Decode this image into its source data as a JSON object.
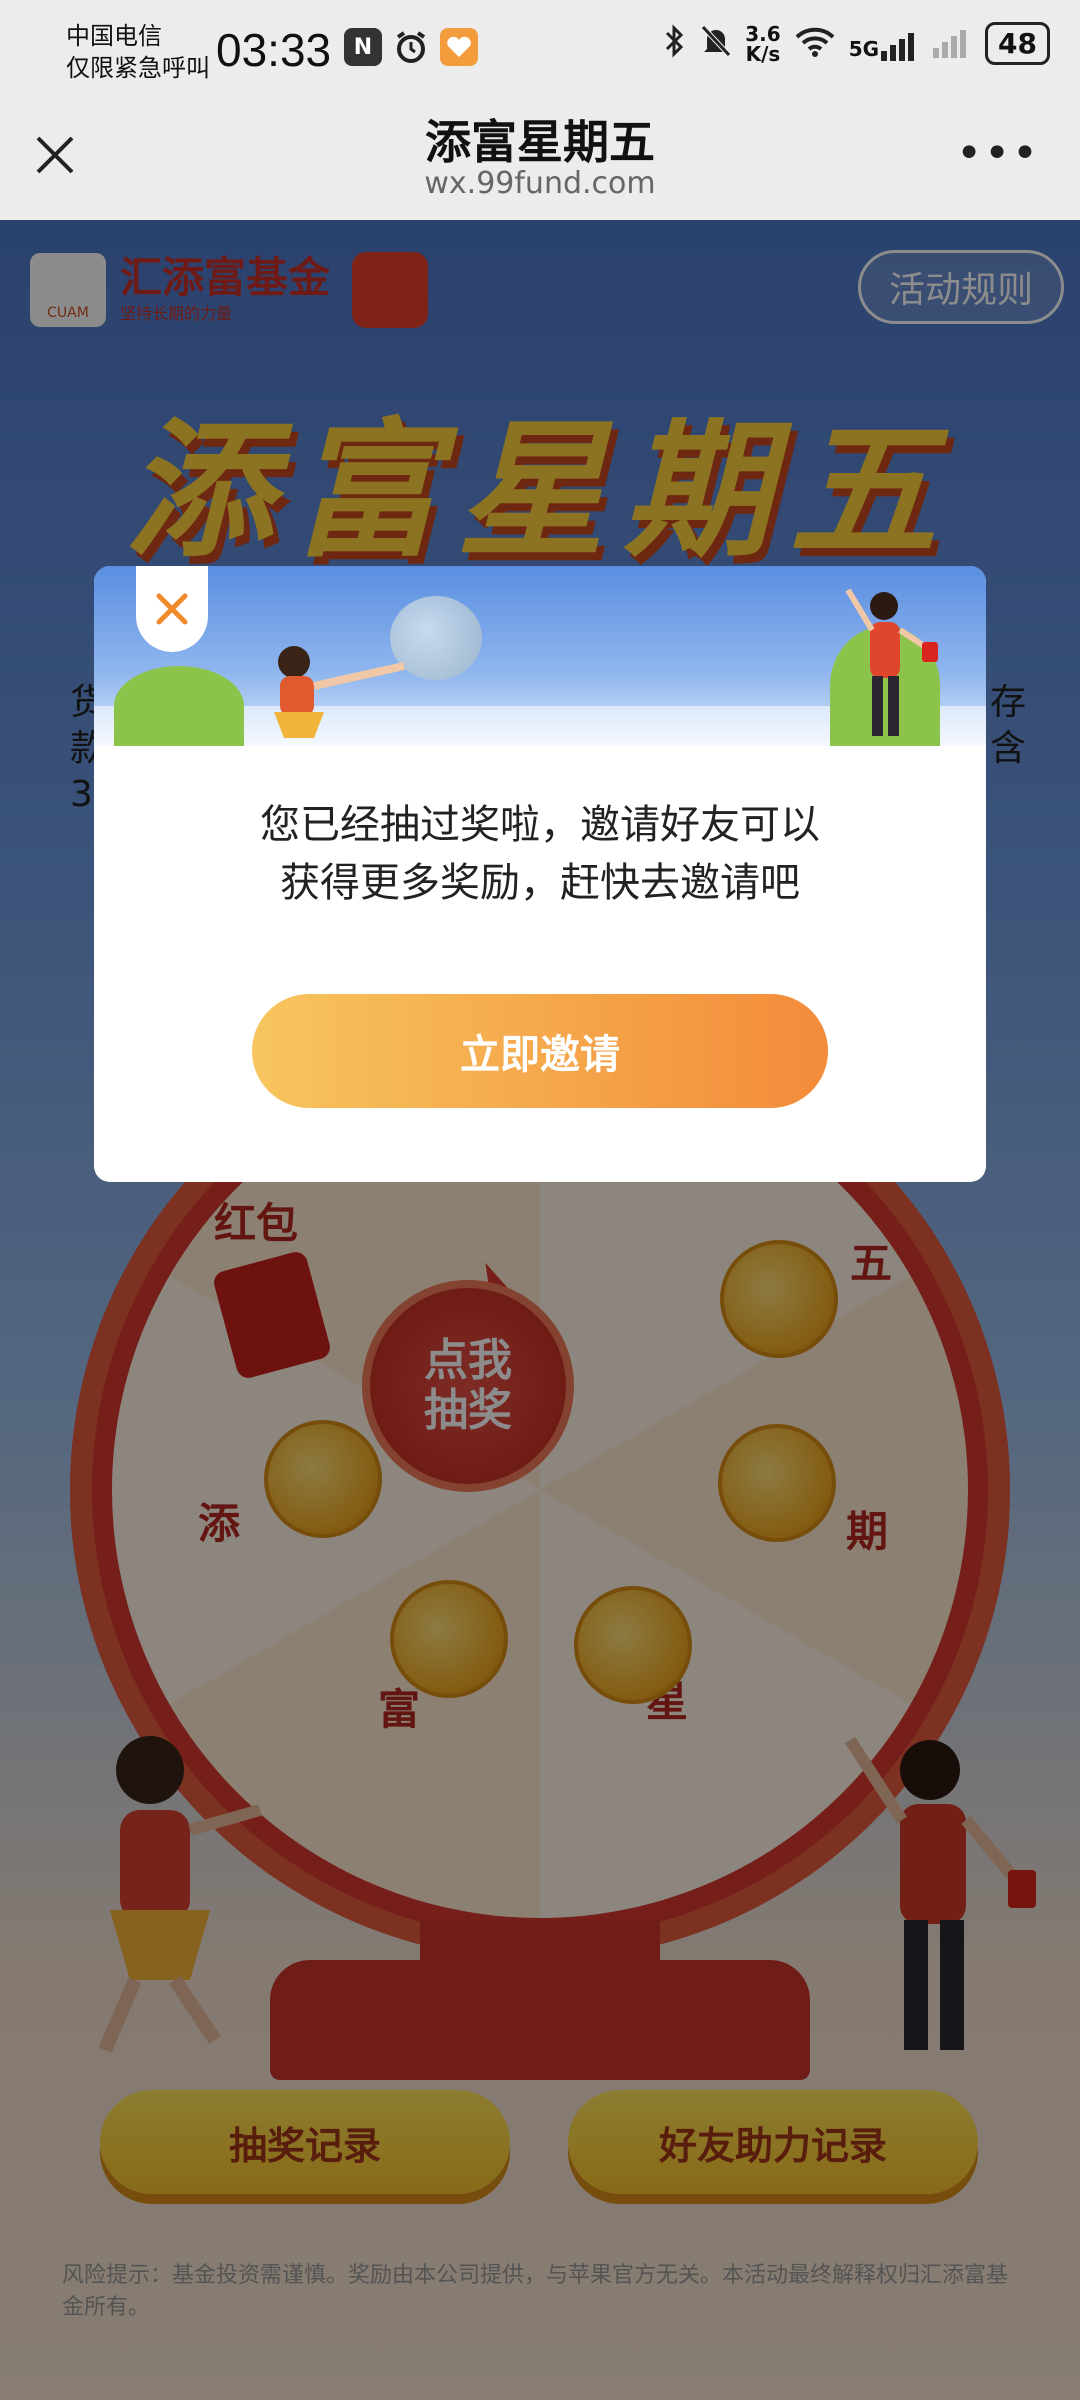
{
  "status_bar": {
    "carrier_line1": "中国电信",
    "carrier_line2": "仅限紧急呼叫",
    "time": "03:33",
    "net_speed_value": "3.6",
    "net_speed_unit": "K/s",
    "signal_label": "5G",
    "battery": "48"
  },
  "nav": {
    "title": "添富星期五",
    "url": "wx.99fund.com"
  },
  "page": {
    "logo_name": "汇添富基金",
    "logo_slogan": "坚持长期的力量",
    "logo_mark_text": "CUAM",
    "rules_button": "活动规则",
    "big_title": "添富星期五",
    "left_fragment": [
      "货",
      "款",
      "3"
    ],
    "right_fragment": [
      "存",
      "含"
    ],
    "wheel": {
      "center_button": "点我\n抽奖",
      "segments": [
        "红包",
        "五",
        "添",
        "期",
        "富",
        "星"
      ]
    },
    "buttons": {
      "draw_record": "抽奖记录",
      "friend_help_record": "好友助力记录"
    },
    "footer_note": "风险提示：基金投资需谨慎。奖励由本公司提供，与苹果官方无关。本活动最终解释权归汇添富基金所有。"
  },
  "modal": {
    "message_line1": "您已经抽过奖啦，邀请好友可以",
    "message_line2": "获得更多奖励，赶快去邀请吧",
    "invite_button": "立即邀请"
  },
  "colors": {
    "accent_orange": "#f38b3a",
    "accent_yellow": "#f7c55e",
    "title_yellow": "#ffd23c",
    "wheel_red": "#d8382f"
  }
}
